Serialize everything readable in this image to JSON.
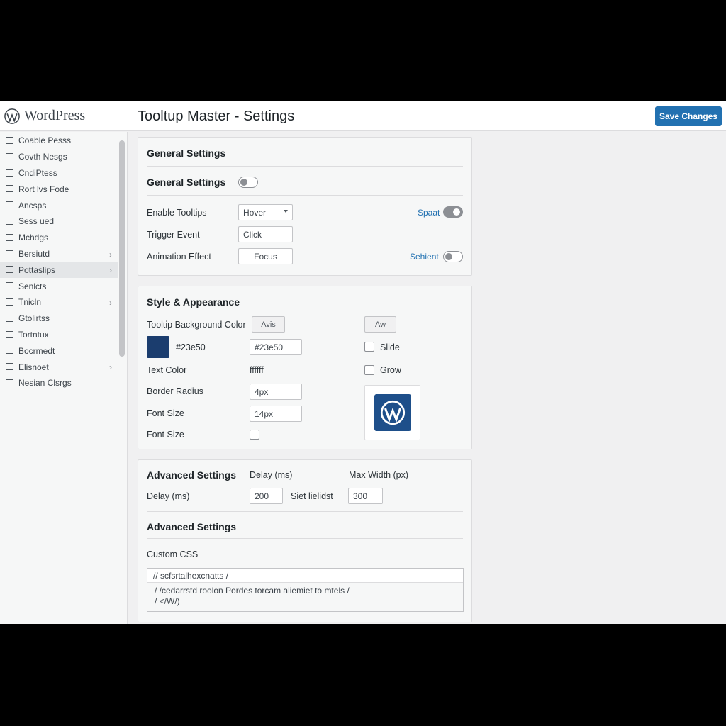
{
  "header": {
    "brand": "WordPress",
    "page_title": "Tooltup Master - Settings",
    "save_label": "Save Changes"
  },
  "sidebar": {
    "items": [
      {
        "label": "Coable Pesss",
        "icon": "dashboard-icon"
      },
      {
        "label": "Covth Nesgs",
        "icon": "posts-icon"
      },
      {
        "label": "CndiPtess",
        "icon": "media-icon"
      },
      {
        "label": "Rort lvs Fode",
        "icon": "pages-icon"
      },
      {
        "label": "Ancsps",
        "icon": "comments-icon"
      },
      {
        "label": "Sess ued",
        "icon": "appearance-icon"
      },
      {
        "label": "Mchdgs",
        "icon": "plugins-icon"
      },
      {
        "label": "Bersiutd",
        "icon": "users-icon",
        "chevron": true
      },
      {
        "label": "Pottaslips",
        "icon": "tools-icon",
        "chevron": true,
        "active": true
      },
      {
        "label": "Senlcts",
        "icon": "settings-icon"
      },
      {
        "label": "Tnicln",
        "icon": "checkbox-icon",
        "chevron": true
      },
      {
        "label": "Gtolirtss",
        "icon": "folder-icon"
      },
      {
        "label": "Tortntux",
        "icon": "template-icon"
      },
      {
        "label": "Bocrmedt",
        "icon": "group-icon"
      },
      {
        "label": "Elisnoet",
        "icon": "grid-icon",
        "chevron": true
      },
      {
        "label": "Nesian Clsrgs",
        "icon": "collapse-icon"
      }
    ]
  },
  "general": {
    "panel_title": "General Settings",
    "section_title": "General Settings",
    "enable_tooltips_label": "Enable Tooltips",
    "enable_tooltips_value": "Hover",
    "trigger_event_label": "Trigger Event",
    "trigger_event_value": "Click",
    "animation_effect_label": "Animation Effect",
    "animation_effect_value": "Focus",
    "toggle_a_label": "Spaat",
    "toggle_b_label": "Sehient"
  },
  "style": {
    "title": "Style & Appearance",
    "bg_color_label": "Tooltip Background Color",
    "btn_a": "Avis",
    "btn_b": "Aw",
    "swatch_color": "#23e50",
    "hex_text": "#23e50",
    "hex_input": "#23e50",
    "slide_label": "Slide",
    "text_color_label": "Text Color",
    "text_color_value": "ffffff",
    "grow_label": "Grow",
    "border_radius_label": "Border Radius",
    "border_radius_value": "4px",
    "font_size_label": "Font Size",
    "font_size_value": "14px",
    "font_size_label_2": "Font Size"
  },
  "advanced": {
    "title": "Advanced Settings",
    "delay_header": "Delay (ms)",
    "max_width_header": "Max Width (px)",
    "delay_label": "Delay (ms)",
    "delay_value": "200",
    "set_label": "Siet lielidst",
    "max_width_value": "300",
    "section_title": "Advanced Settings",
    "custom_css_label": "Custom CSS",
    "css_line1": "// scfsrtalhexcnatts /",
    "css_line2": "/   /cedarrstd roolon Pordes torcam aliemiet to mtels /",
    "css_line3": "/   </W/)"
  },
  "colors": {
    "accent": "#2271b1",
    "wp_badge": "#1e4f8a"
  }
}
